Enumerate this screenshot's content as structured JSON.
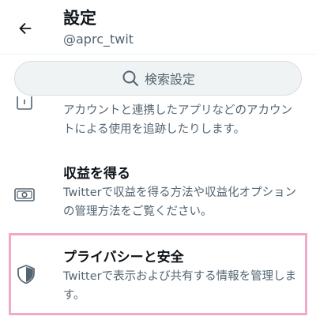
{
  "header": {
    "title": "設定",
    "handle": "@aprc_twit"
  },
  "search": {
    "placeholder": "検索設定"
  },
  "items": [
    {
      "title": "",
      "description": "アカウントと連携したアプリなどのアカウントによる使用を追跡したりします。",
      "icon": "apps-icon"
    },
    {
      "title": "収益を得る",
      "description": "Twitterで収益を得る方法や収益化オプションの管理方法をご覧ください。",
      "icon": "money-icon"
    },
    {
      "title": "プライバシーと安全",
      "description": "Twitterで表示および共有する情報を管理します。",
      "icon": "shield-icon"
    }
  ],
  "colors": {
    "highlight_border": "#f1a9c9",
    "secondary_text": "#536471",
    "search_bg": "#eff3f4"
  }
}
